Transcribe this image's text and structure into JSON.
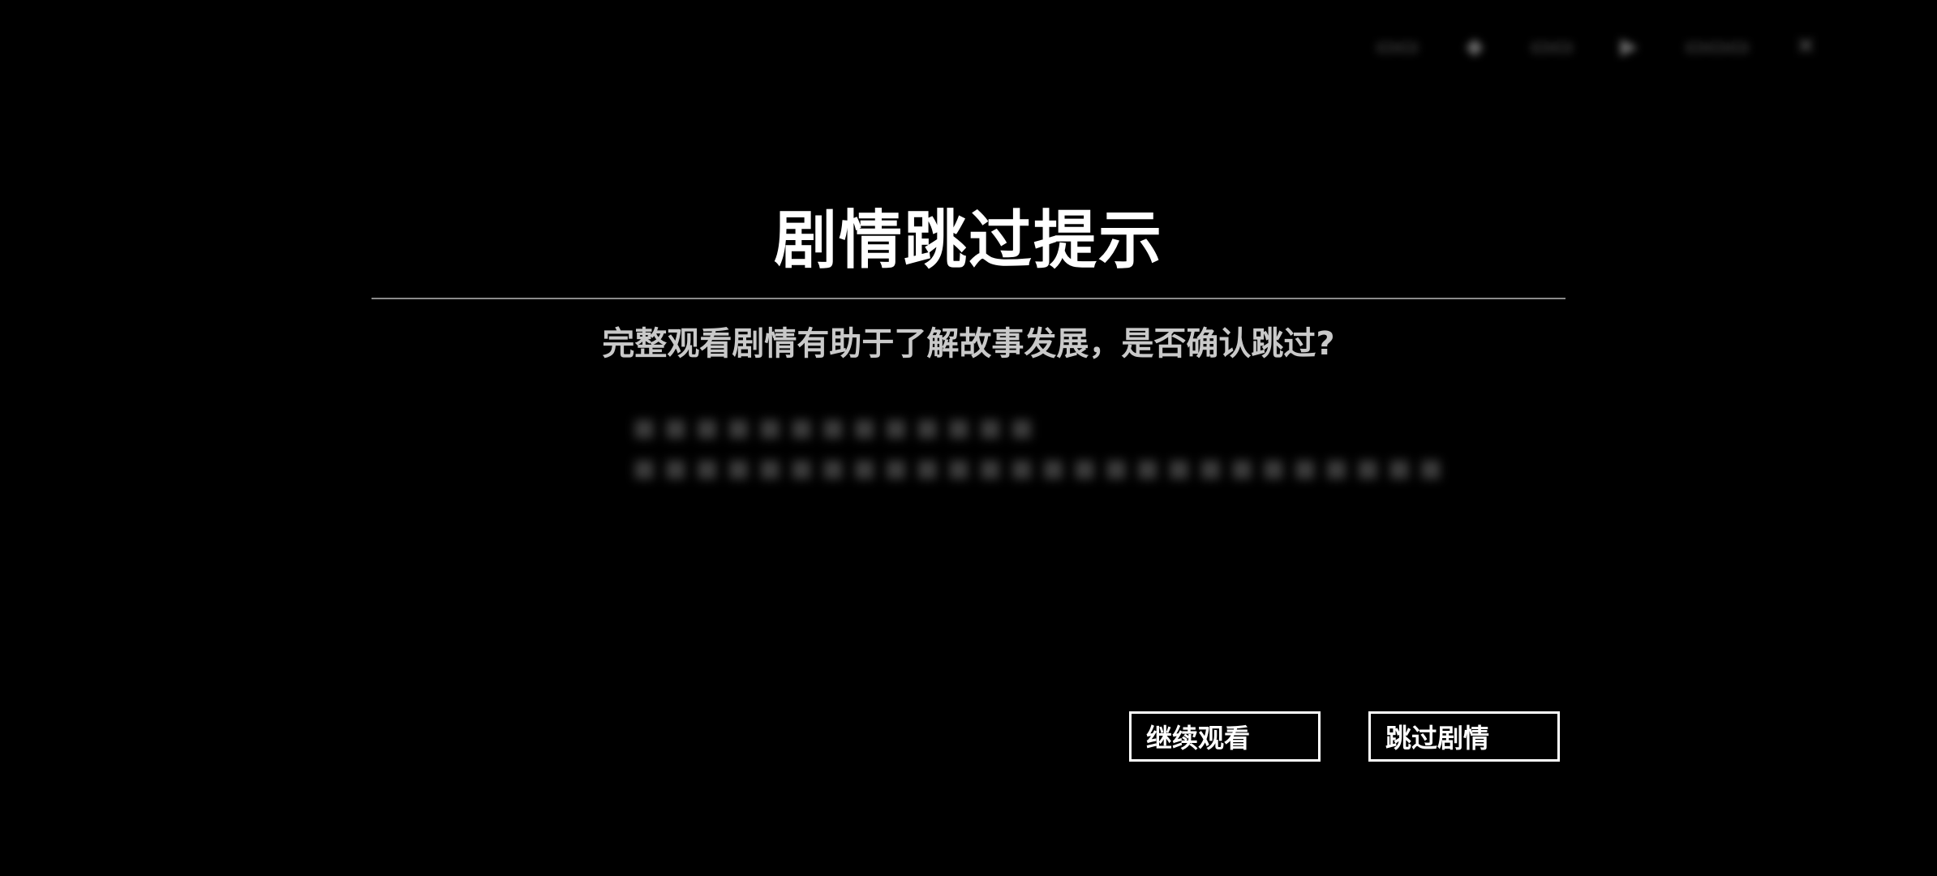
{
  "dialog": {
    "title": "剧情跳过提示",
    "message": "完整观看剧情有助于了解故事发展，是否确认跳过?",
    "continue_label": "继续观看",
    "skip_label": "跳过剧情"
  },
  "background_hud": {
    "icons": [
      "menu-icon",
      "chat-icon",
      "play-icon",
      "close-icon"
    ]
  },
  "colors": {
    "background": "#000000",
    "title": "#ffffff",
    "message": "#c9c9c9",
    "divider": "#8a8a8a",
    "button_border": "#ffffff"
  }
}
